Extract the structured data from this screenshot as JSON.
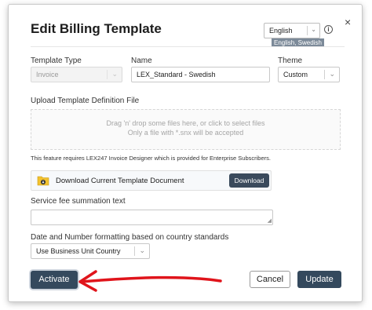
{
  "dialog": {
    "title": "Edit Billing Template",
    "close_label": "×",
    "language": {
      "selected": "English",
      "tooltip": "English, Swedish"
    },
    "info_label": "i"
  },
  "form": {
    "template_type": {
      "label": "Template Type",
      "value": "Invoice"
    },
    "name": {
      "label": "Name",
      "value": "LEX_Standard - Swedish"
    },
    "theme": {
      "label": "Theme",
      "value": "Custom"
    },
    "upload": {
      "label": "Upload Template Definition File",
      "drop_line1": "Drag 'n' drop some files here, or click to select files",
      "drop_line2": "Only a file with *.snx will be accepted",
      "note": "This feature requires LEX247 Invoice Designer which is provided for Enterprise Subscribers."
    },
    "download": {
      "text": "Download Current Template Document",
      "button": "Download"
    },
    "service_fee": {
      "label": "Service fee summation text",
      "value": ""
    },
    "formatting": {
      "label": "Date and Number formatting based on country standards",
      "value": "Use Business Unit Country"
    }
  },
  "footer": {
    "activate": "Activate",
    "cancel": "Cancel",
    "update": "Update"
  },
  "annotation": {
    "arrow_color": "#e0141b"
  },
  "icons": {
    "close": "close-icon",
    "info": "info-icon",
    "folder": "folder-download-icon",
    "chevron": "chevron-down-icon"
  }
}
